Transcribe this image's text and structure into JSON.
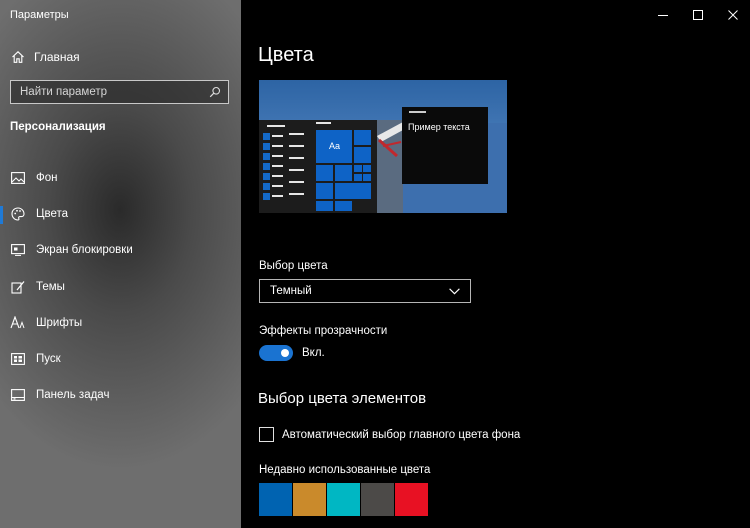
{
  "window": {
    "title": "Параметры",
    "controls": {
      "minimize": "—",
      "maximize": "☐",
      "close": "✕"
    }
  },
  "sidebar": {
    "home_label": "Главная",
    "search_placeholder": "Найти параметр",
    "section_title": "Персонализация",
    "items": [
      {
        "label": "Фон",
        "icon": "image-icon",
        "active": false
      },
      {
        "label": "Цвета",
        "icon": "palette-icon",
        "active": true
      },
      {
        "label": "Экран блокировки",
        "icon": "lock-screen-icon",
        "active": false
      },
      {
        "label": "Темы",
        "icon": "brush-icon",
        "active": false
      },
      {
        "label": "Шрифты",
        "icon": "font-icon",
        "active": false
      },
      {
        "label": "Пуск",
        "icon": "start-icon",
        "active": false
      },
      {
        "label": "Панель задач",
        "icon": "taskbar-icon",
        "active": false
      }
    ]
  },
  "main": {
    "title": "Цвета",
    "preview": {
      "sample_text": "Пример текста",
      "tile_text": "Aa"
    },
    "color_choice": {
      "label": "Выбор цвета",
      "selected": "Темный"
    },
    "transparency": {
      "label": "Эффекты прозрачности",
      "state_label": "Вкл.",
      "on": true
    },
    "accent_heading": "Выбор цвета элементов",
    "auto_accent_label": "Автоматический выбор главного цвета фона",
    "recent_label": "Недавно использованные цвета",
    "recent_colors": [
      "#0063b1",
      "#ca8a2b",
      "#00b7c3",
      "#4c4a48",
      "#e81123"
    ]
  },
  "colors": {
    "accent": "#1a73d1",
    "sidebar_active_marker": "#1f7ad6"
  }
}
